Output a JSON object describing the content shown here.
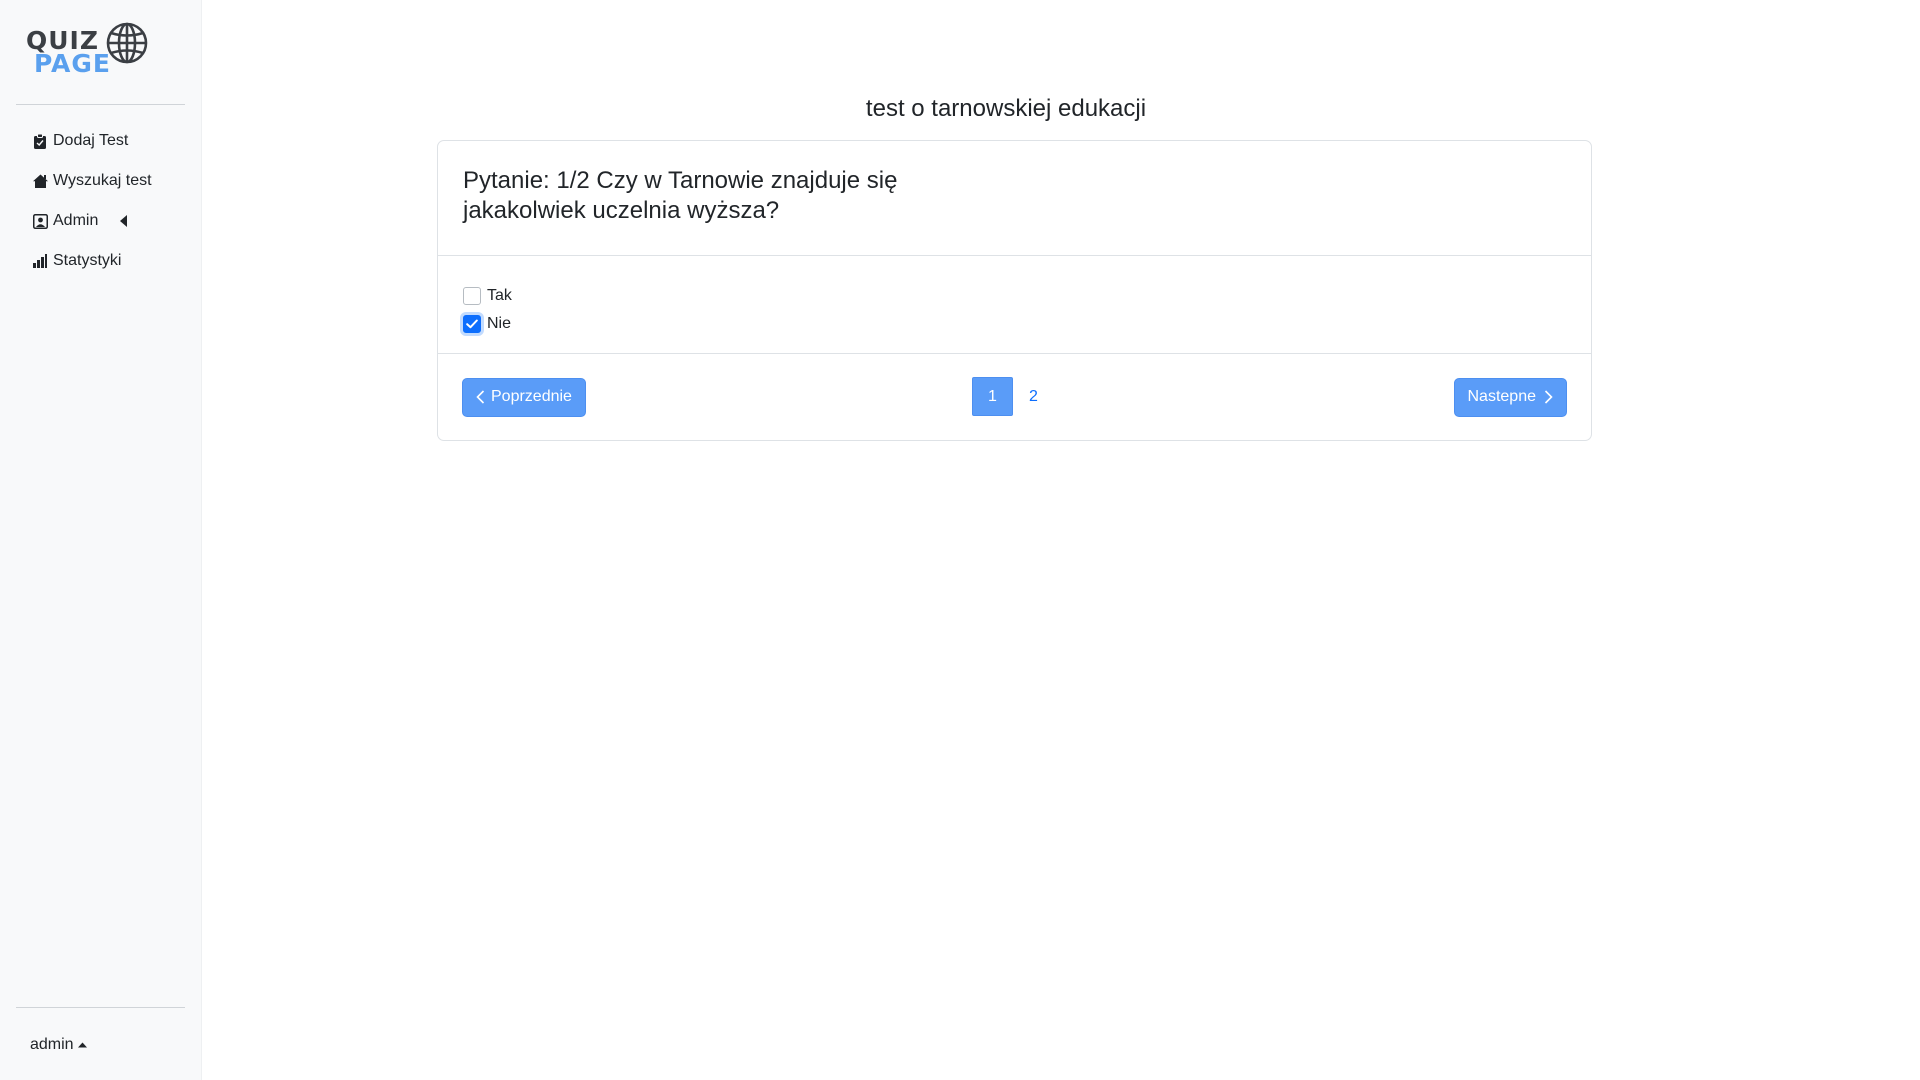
{
  "brand": {
    "line1": "QUIZ",
    "line2": "PAGE"
  },
  "sidebar": {
    "items": [
      {
        "label": "Dodaj Test",
        "icon": "clipboard-icon"
      },
      {
        "label": "Wyszukaj test",
        "icon": "home-icon"
      },
      {
        "label": "Admin",
        "icon": "person-badge-icon"
      },
      {
        "label": "Statystyki",
        "icon": "bar-chart-icon"
      }
    ],
    "user": "admin"
  },
  "main": {
    "title": "test o tarnowskiej edukacji",
    "question": "Pytanie: 1/2 Czy w Tarnowie znajduje się jakakolwiek uczelnia wyższa?",
    "options": [
      {
        "label": "Tak",
        "checked": false
      },
      {
        "label": "Nie",
        "checked": true
      }
    ],
    "prev_label": "Poprzednie",
    "next_label": "Nastepne",
    "pages": [
      "1",
      "2"
    ],
    "current_page": "1"
  },
  "colors": {
    "accent": "#0d6efd",
    "button": "#5a9cf8",
    "brand_dark": "#3b3f44",
    "brand_blue": "#5aa0ee",
    "sidebar_bg": "#f8f9fa"
  }
}
